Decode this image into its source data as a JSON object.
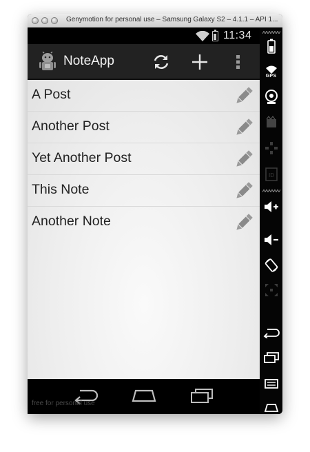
{
  "window": {
    "title": "Genymotion for personal use – Samsung Galaxy S2 – 4.1.1 – API 1..."
  },
  "statusbar": {
    "time": "11:34",
    "icons": [
      "wifi-icon",
      "battery-icon"
    ]
  },
  "actionbar": {
    "app_title": "NoteApp",
    "app_icon": "android-robot-icon",
    "actions": [
      "refresh-icon",
      "add-icon",
      "overflow-menu-icon"
    ]
  },
  "notes": [
    {
      "title": "A Post"
    },
    {
      "title": "Another Post"
    },
    {
      "title": "Yet Another Post"
    },
    {
      "title": "This Note"
    },
    {
      "title": "Another Note"
    }
  ],
  "navbar": {
    "buttons": [
      "back-icon",
      "home-icon",
      "recent-apps-icon"
    ],
    "watermark": "free for personal use"
  },
  "sidebar": {
    "gps_label": "GPS",
    "id_label": "ID",
    "buttons": [
      "battery-widget-icon",
      "gps-widget-icon",
      "camera-widget-icon",
      "video-widget-icon",
      "dpad-widget-icon",
      "id-widget-icon",
      "volume-up-icon",
      "volume-down-icon",
      "rotate-icon",
      "scale-icon",
      "back-icon",
      "recent-apps-icon",
      "menu-icon",
      "home-icon"
    ]
  },
  "colors": {
    "actionbar_bg": "#222222",
    "list_bg": "#eeeeee",
    "divider": "#d9d9d9",
    "text": "#222222"
  }
}
